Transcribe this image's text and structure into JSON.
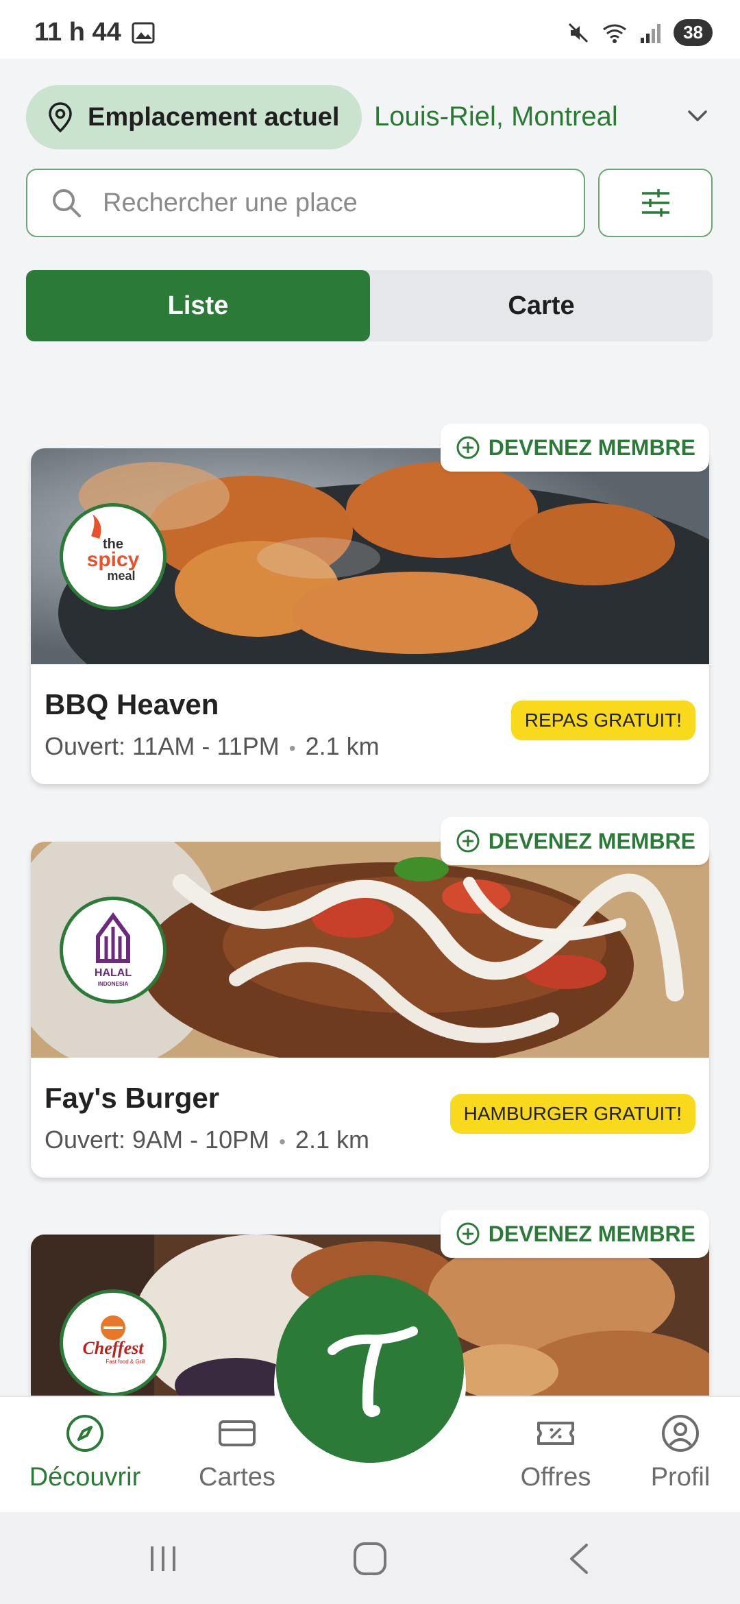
{
  "status_bar": {
    "time": "11 h 44",
    "battery": "38"
  },
  "location": {
    "pill_label": "Emplacement actuel",
    "city": "Louis-Riel, Montreal"
  },
  "search": {
    "placeholder": "Rechercher une place"
  },
  "view_toggle": {
    "list_label": "Liste",
    "map_label": "Carte"
  },
  "restaurants": [
    {
      "name": "BBQ Heaven",
      "hours": "Ouvert: 11AM - 11PM",
      "distance": "2.1 km",
      "offer": "REPAS GRATUIT!",
      "member_label": "DEVENEZ MEMBRE",
      "logo_text": "the spicy meal"
    },
    {
      "name": "Fay's Burger",
      "hours": "Ouvert: 9AM - 10PM",
      "distance": "2.1 km",
      "offer": "HAMBURGER GRATUIT!",
      "member_label": "DEVENEZ MEMBRE",
      "logo_text": "HALAL INDONESIA"
    },
    {
      "member_label": "DEVENEZ MEMBRE",
      "logo_text": "Cheffest"
    }
  ],
  "bottom_nav": {
    "items": [
      {
        "label": "Découvrir",
        "icon": "compass-icon"
      },
      {
        "label": "Cartes",
        "icon": "card-icon"
      },
      {
        "label": "Offres",
        "icon": "ticket-icon"
      },
      {
        "label": "Profil",
        "icon": "user-icon"
      }
    ]
  },
  "colors": {
    "primary": "#2b7a38",
    "accent_yellow": "#f9d91b",
    "pill_bg": "#c9e3cf"
  }
}
